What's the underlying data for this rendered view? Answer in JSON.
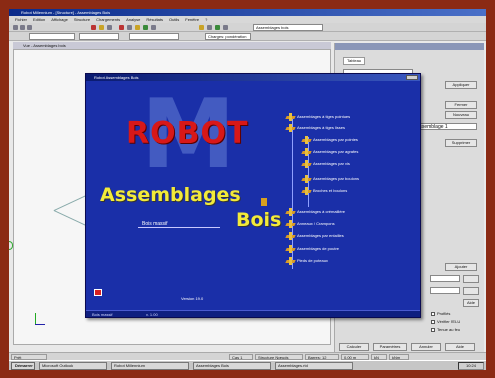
{
  "app": {
    "title": "Robot Millennium - [Structure] - Assemblages Bois",
    "menu": [
      "Fichier",
      "Edition",
      "Affichage",
      "Structure",
      "Chargements",
      "Analyse",
      "Résultats",
      "Outils",
      "Fenêtre",
      "?"
    ],
    "toolbar_combo_1": "Assemblages bois",
    "toolbar_combo_2": "Charges: pondération",
    "viewport_title": "Vue - Assemblages bois"
  },
  "panel": {
    "tab": "Tableau",
    "buttons": [
      "Appliquer",
      "Fermer",
      "Nouveau",
      "Supprimer",
      "Ajouter",
      "Aide"
    ],
    "bottom_buttons": [
      "Calculer",
      "Paramètres",
      "Annuler",
      "Aide"
    ],
    "checkbox_1": "Profilés",
    "checkbox_2": "Vérifier l'ELU",
    "checkbox_3": "Tenue au feu",
    "dropdown_value": "Assemblage 1"
  },
  "dialog": {
    "title": "Robot Assemblages Bois",
    "logo_letter": "M",
    "logo_word": "ROBOT",
    "headline_1": "Assemblages",
    "headline_2": "Bois",
    "material_label": "Bois massif",
    "version": "Version 19.0",
    "status_left": "Bois massif",
    "status_right": "v. 1.00"
  },
  "tree": [
    "Assemblages à tiges pointues",
    "Assemblages à tiges lisses",
    "Assemblages par pointes",
    "Assemblages par agrafes",
    "Assemblages par vis",
    "Assemblages par boulons",
    "Broches et boulons",
    "Assemblages à crémaillère",
    "Anneaux / Crampons",
    "Assemblages par entailles",
    "Assemblages de poutre",
    "Pieds de poteaux"
  ],
  "statusbar": [
    "Prêt",
    "Cas 1",
    "Structure Nœuds",
    "Barres: 12",
    "0.00 m",
    "kN",
    "kNm"
  ],
  "taskbar": {
    "start": "Démarrer",
    "tasks": [
      "Microsoft Outlook",
      "Robot Millennium",
      "Assemblages Bois",
      "Assemblages.rtd"
    ],
    "clock": "10:24"
  }
}
